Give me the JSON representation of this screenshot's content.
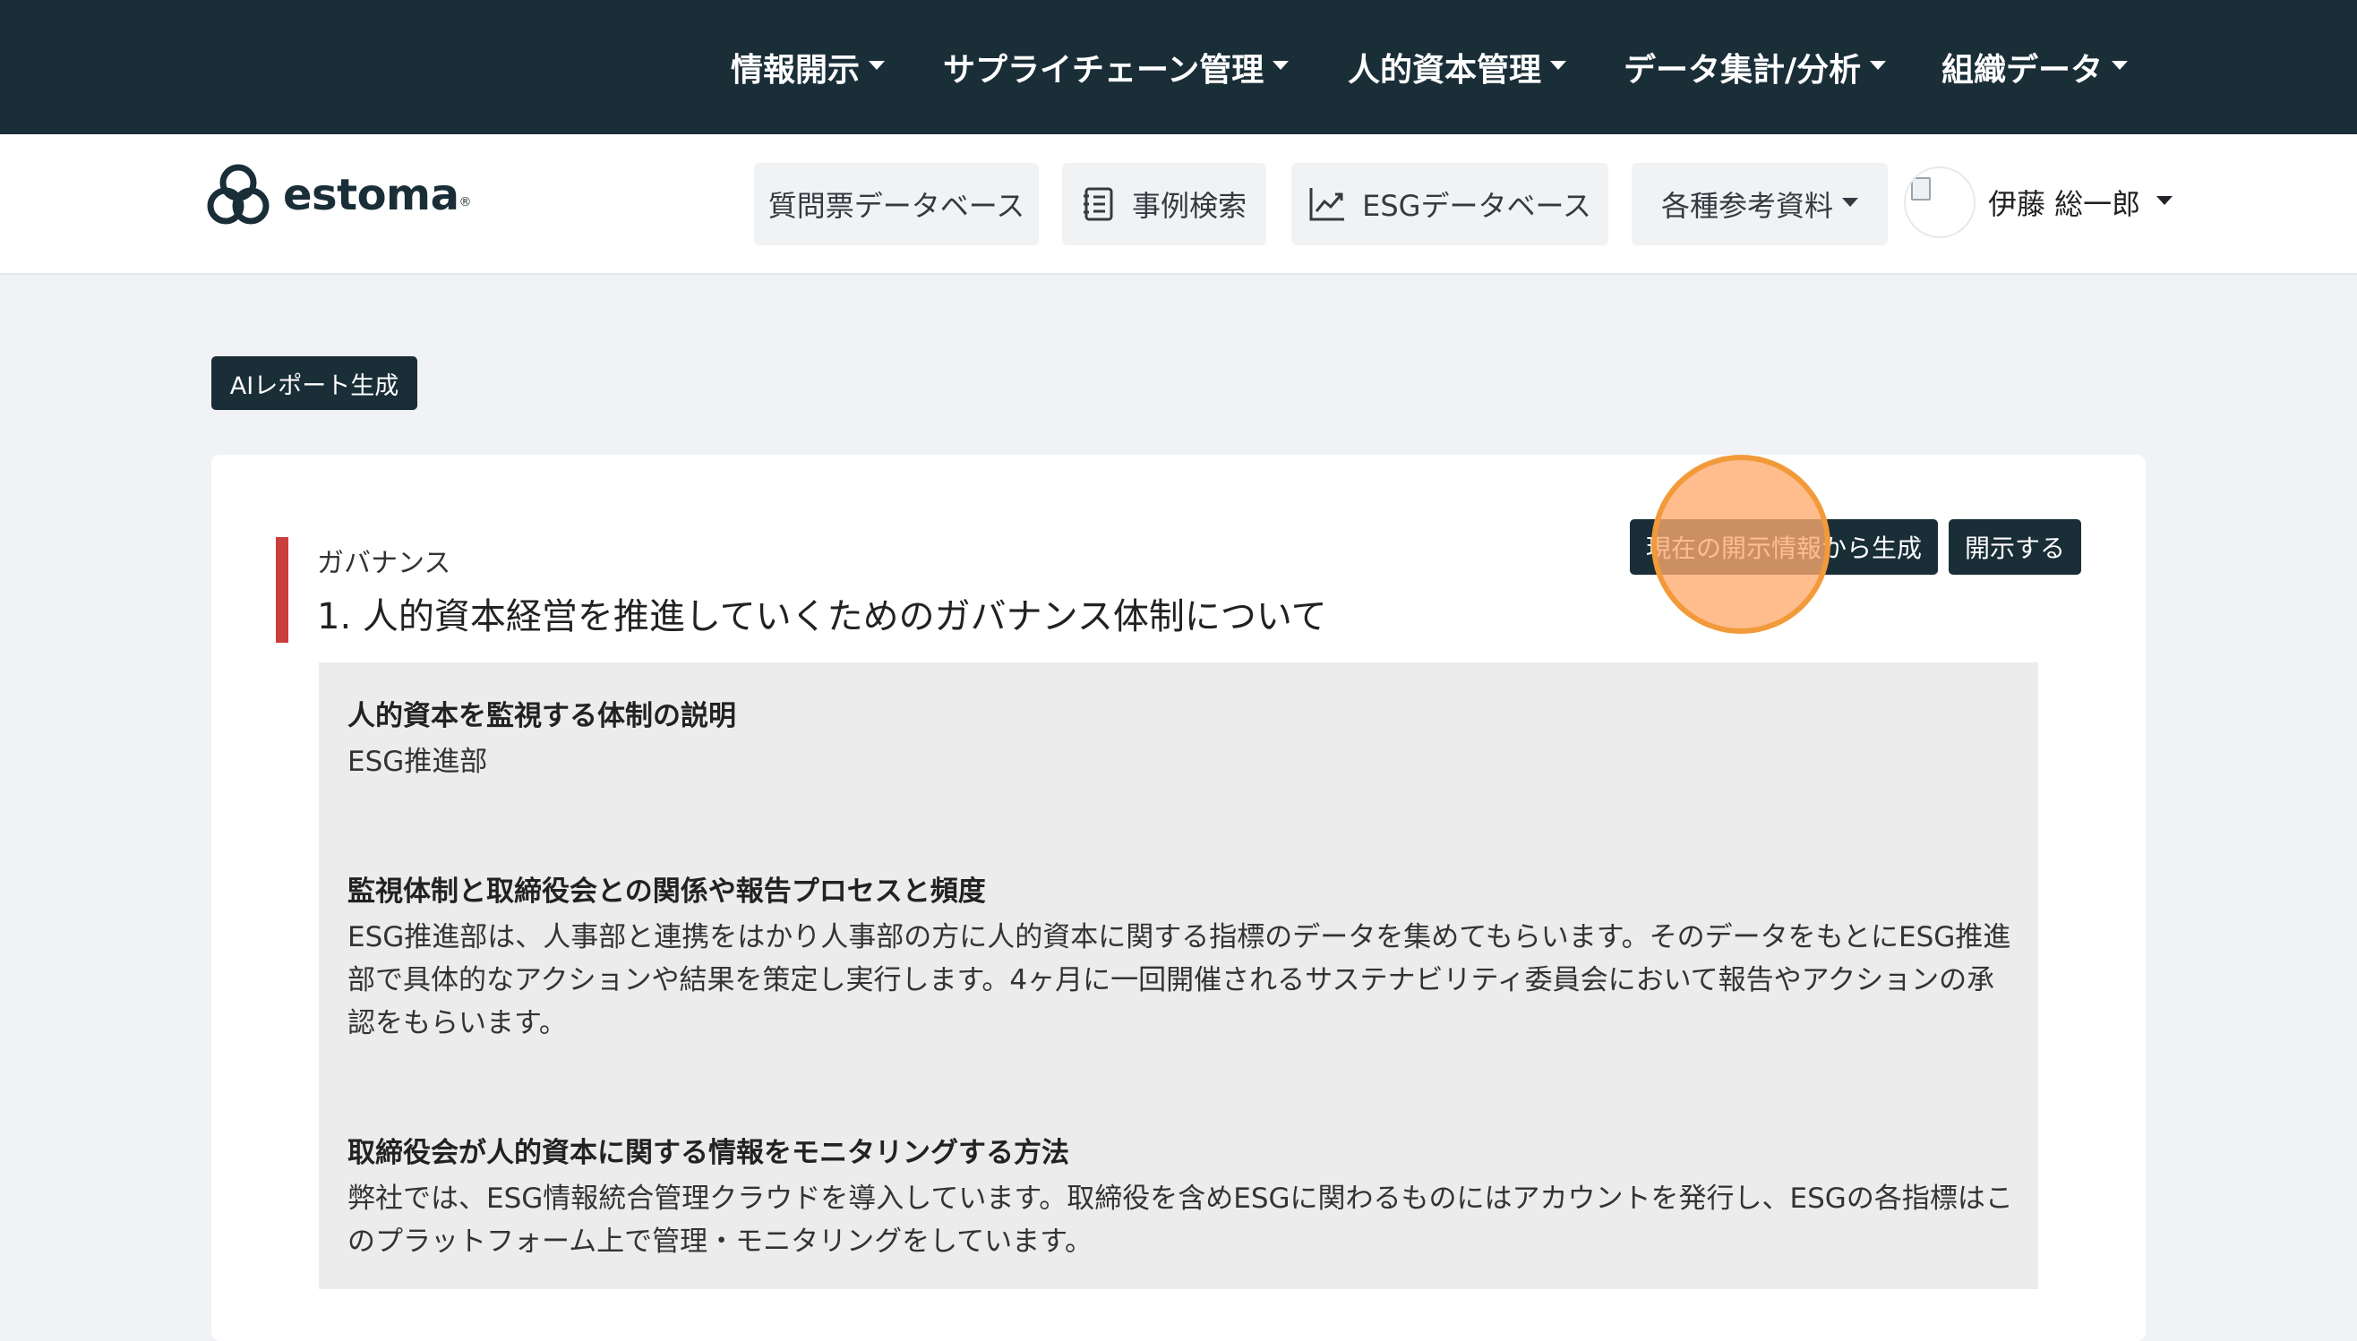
{
  "top_nav": {
    "items": [
      {
        "label": "情報開示"
      },
      {
        "label": "サプライチェーン管理"
      },
      {
        "label": "人的資本管理"
      },
      {
        "label": "データ集計/分析"
      },
      {
        "label": "組織データ"
      }
    ]
  },
  "brand": {
    "name": "estoma",
    "color": "#1a2e38"
  },
  "sub_nav": {
    "questionnaire_db": "質問票データベース",
    "case_search": "事例検索",
    "esg_db": "ESGデータベース",
    "references": "各種参考資料",
    "user_name": "伊藤 総一郎"
  },
  "ai_report_button": "AIレポート生成",
  "section": {
    "category": "ガバナンス",
    "title": "1. 人的資本経営を推進していくためのガバナンス体制について",
    "generate_button": "現在の開示情報から生成",
    "disclose_button": "開示する",
    "accent_color": "#cc3d3d",
    "qa": [
      {
        "heading": "人的資本を監視する体制の説明",
        "body": "ESG推進部"
      },
      {
        "heading": "監視体制と取締役会との関係や報告プロセスと頻度",
        "body": "ESG推進部は、人事部と連携をはかり人事部の方に人的資本に関する指標のデータを集めてもらいます。そのデータをもとにESG推進部で具体的なアクションや結果を策定し実行します。4ヶ月に一回開催されるサステナビリティ委員会において報告やアクションの承認をもらいます。"
      },
      {
        "heading": "取締役会が人的資本に関する情報をモニタリングする方法",
        "body": "弊社では、ESG情報統合管理クラウドを導入しています。取締役を含めESGに関わるものにはアカウントを発行し、ESGの各指標はこのプラットフォーム上で管理・モニタリングをしています。"
      }
    ]
  },
  "icons": {
    "logo": "estoma-logo-icon",
    "case_search": "notebook-icon",
    "esg_db": "line-chart-icon",
    "dropdown": "caret-down-icon"
  }
}
